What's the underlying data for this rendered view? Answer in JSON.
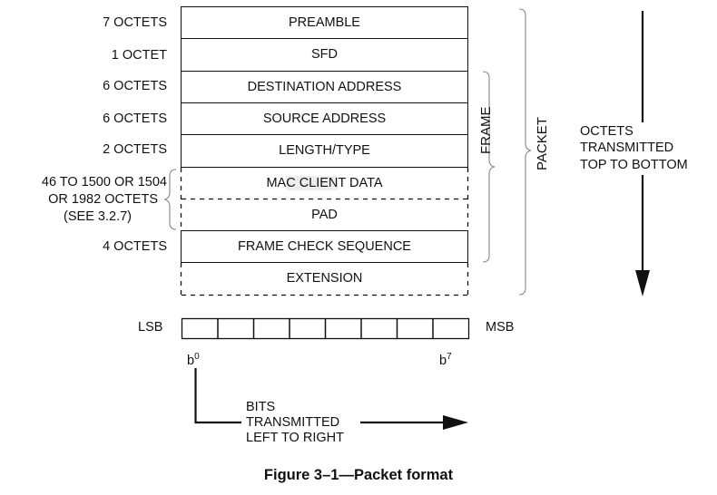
{
  "figure": {
    "caption": "Figure 3–1—Packet format"
  },
  "packet": {
    "fields": [
      {
        "name": "PREAMBLE",
        "size": "7 OCTETS",
        "border": "solid"
      },
      {
        "name": "SFD",
        "size": "1 OCTET",
        "border": "solid"
      },
      {
        "name": "DESTINATION ADDRESS",
        "size": "6 OCTETS",
        "border": "solid"
      },
      {
        "name": "SOURCE ADDRESS",
        "size": "6 OCTETS",
        "border": "solid"
      },
      {
        "name": "LENGTH/TYPE",
        "size": "2 OCTETS",
        "border": "solid"
      },
      {
        "name": "MAC CLIENT DATA",
        "name_parts": [
          "MA",
          "C CLIEN",
          "T DATA"
        ],
        "size": "",
        "border": "dashed"
      },
      {
        "name": "PAD",
        "size": "",
        "border": "dashed"
      },
      {
        "name": "FRAME CHECK SEQUENCE",
        "size": "4 OCTETS",
        "border": "solid"
      },
      {
        "name": "EXTENSION",
        "size": "",
        "border": "dashed"
      }
    ],
    "data_pad_size": [
      "46 TO 1500 OR 1504",
      "OR 1982 OCTETS",
      "(SEE 3.2.7)"
    ],
    "frame_label": "FRAME",
    "packet_label": "PACKET",
    "octet_direction": [
      "OCTETS",
      "TRANSMITTED",
      "TOP TO BOTTOM"
    ]
  },
  "bits": {
    "lsb_label": "LSB",
    "msb_label": "MSB",
    "count": 8,
    "first_bit": {
      "base": "b",
      "exp": "0"
    },
    "last_bit": {
      "base": "b",
      "exp": "7"
    },
    "bit_direction": [
      "BITS",
      "TRANSMITTED",
      "LEFT TO RIGHT"
    ]
  }
}
